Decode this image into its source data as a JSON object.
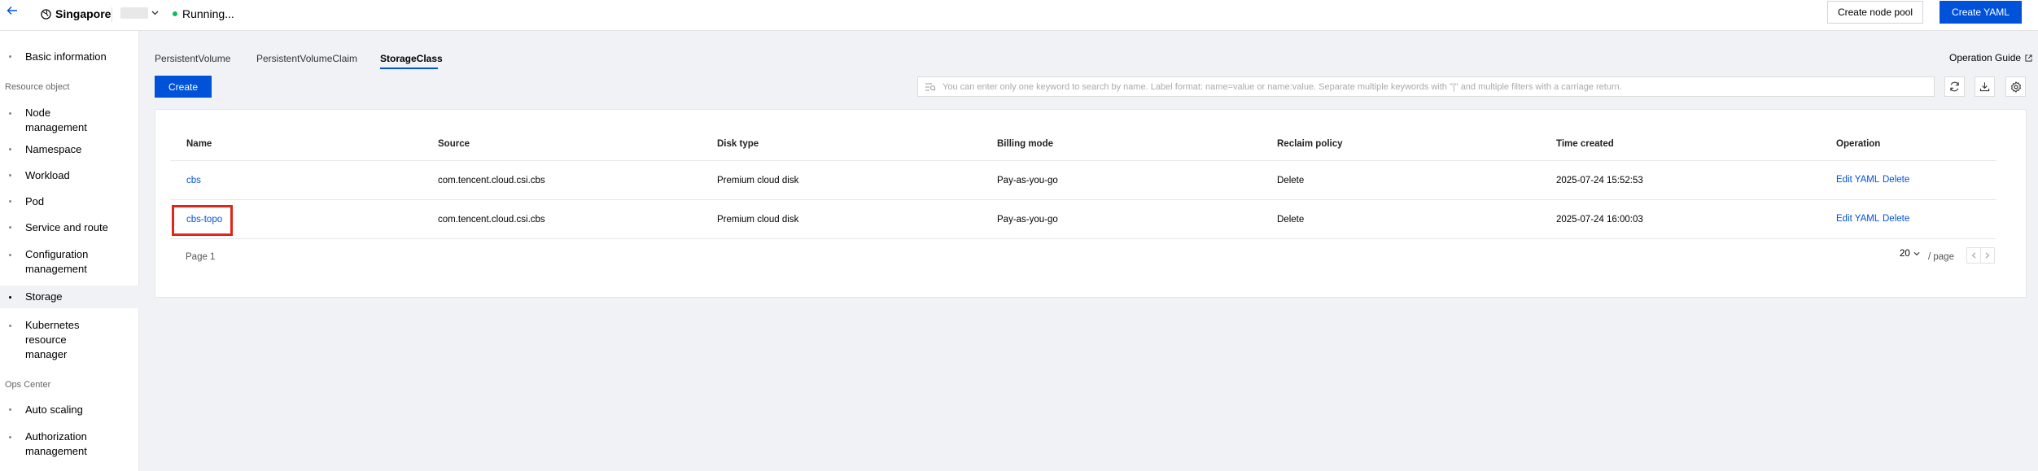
{
  "topbar": {
    "back_icon": "arrow-left-icon",
    "region": "Singapore",
    "status": "Running...",
    "create_node_pool": "Create node pool",
    "create_yaml": "Create YAML"
  },
  "sidebar": {
    "items": [
      {
        "label": "Basic information"
      },
      {
        "label": "Node management"
      },
      {
        "label": "Namespace"
      },
      {
        "label": "Workload"
      },
      {
        "label": "Pod"
      },
      {
        "label": "Service and route"
      },
      {
        "label": "Configuration management"
      },
      {
        "label": "Storage"
      },
      {
        "label": "Kubernetes resource manager"
      },
      {
        "label": "Auto scaling"
      },
      {
        "label": "Authorization management"
      }
    ],
    "sections": {
      "resource_object": "Resource object",
      "ops_center": "Ops Center"
    }
  },
  "tabs": [
    "PersistentVolume",
    "PersistentVolumeClaim",
    "StorageClass"
  ],
  "active_tab": "StorageClass",
  "operation_guide": "Operation Guide",
  "create_button": "Create",
  "search": {
    "placeholder": "You can enter only one keyword to search by name. Label format: name=value or name:value. Separate multiple keywords with \"|\" and multiple filters with a carriage return."
  },
  "table": {
    "columns": [
      "Name",
      "Source",
      "Disk type",
      "Billing mode",
      "Reclaim policy",
      "Time created",
      "Operation"
    ],
    "rows": [
      {
        "name": "cbs",
        "source": "com.tencent.cloud.csi.cbs",
        "disk_type": "Premium cloud disk",
        "billing_mode": "Pay-as-you-go",
        "reclaim_policy": "Delete",
        "time_created": "2025-07-24 15:52:53",
        "op_edit": "Edit YAML",
        "op_delete": "Delete"
      },
      {
        "name": "cbs-topo",
        "source": "com.tencent.cloud.csi.cbs",
        "disk_type": "Premium cloud disk",
        "billing_mode": "Pay-as-you-go",
        "reclaim_policy": "Delete",
        "time_created": "2025-07-24 16:00:03",
        "op_edit": "Edit YAML",
        "op_delete": "Delete"
      }
    ]
  },
  "pagination": {
    "page_label": "Page 1",
    "page_size": "20",
    "per_page": "/ page"
  },
  "colors": {
    "primary": "#0052d9",
    "highlight": "#e1251b",
    "status_running": "#0abf5b"
  }
}
